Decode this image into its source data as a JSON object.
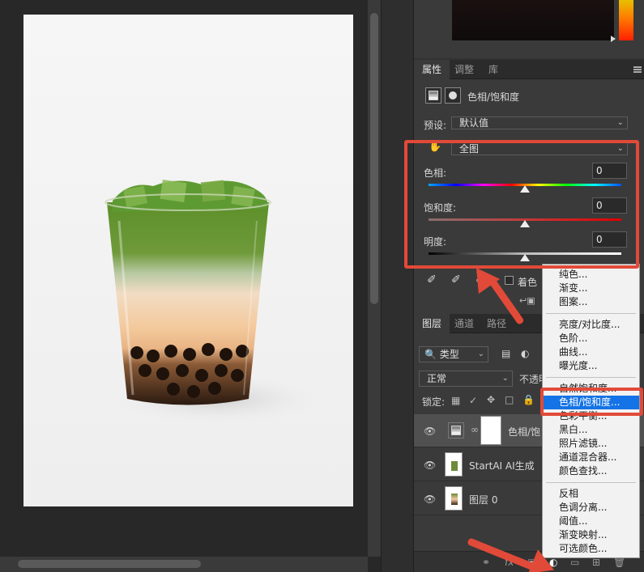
{
  "properties": {
    "tabs": [
      "属性",
      "调整",
      "库"
    ],
    "adjustment_title": "色相/饱和度",
    "preset_label": "预设:",
    "preset_value": "默认值",
    "channel_value": "全图",
    "hue_label": "色相:",
    "hue_value": "0",
    "saturation_label": "饱和度:",
    "saturation_value": "0",
    "lightness_label": "明度:",
    "lightness_value": "0",
    "colorize_label": "着色",
    "hue_level": 0.5,
    "saturation_level": 0.5,
    "lightness_level": 0.5
  },
  "layers": {
    "tabs": [
      "图层",
      "通道",
      "路径"
    ],
    "filter_label": "类型",
    "blend_mode": "正常",
    "opacity_label": "不透明",
    "lock_label": "锁定:",
    "items": [
      {
        "name": "色相/饱"
      },
      {
        "name": "StartAI AI生成"
      },
      {
        "name": "图层 0"
      }
    ],
    "bottom_icons": [
      "link-icon",
      "fx-icon",
      "adjustment-icon",
      "mask-icon",
      "new-layer-icon",
      "trash-icon"
    ]
  },
  "context_menu": {
    "items": [
      [
        "纯色...",
        "渐变...",
        "图案..."
      ],
      [
        "亮度/对比度...",
        "色阶...",
        "曲线...",
        "曝光度..."
      ],
      [
        "自然饱和度...",
        "色相/饱和度...",
        "色彩平衡...",
        "黑白...",
        "照片滤镜...",
        "通道混合器...",
        "颜色查找..."
      ],
      [
        "反相",
        "色调分离...",
        "阈值...",
        "渐变映射...",
        "可选颜色..."
      ]
    ],
    "highlighted": "色相/饱和度..."
  },
  "colors": {
    "annotation_red": "#e14a38",
    "highlight_blue": "#1473e6",
    "matcha_green": "#5f8a2e",
    "tea_cream": "#f0cba0"
  }
}
